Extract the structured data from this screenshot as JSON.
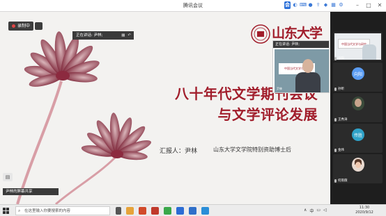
{
  "window": {
    "title": "腾讯会议"
  },
  "toolbar_icons": [
    "app-icon",
    "chat-icon",
    "keyboard-icon",
    "mic-icon",
    "share-icon",
    "shirt-icon",
    "grid-icon",
    "settings-icon"
  ],
  "stage": {
    "recording_label": "录制中",
    "speaking_label": "正在讲话: 尹林;",
    "slide": {
      "title_line1": "八十年代文学期刊会议",
      "title_line2": "与文学评论发展",
      "reporter": "汇报人：尹林",
      "organization": "山东大学文学院特别资助博士后",
      "logo_text": "山东大学",
      "accent_color": "#a11d2b"
    },
    "floating_video": {
      "header": "正在讲话: 尹林;",
      "banner": "中国当代文学与研究",
      "name": "尹林"
    },
    "screen_share_tag": "尹林的屏幕共享"
  },
  "participants": [
    {
      "name": "张阳",
      "type": "video",
      "banner": "中国当代文学与研究"
    },
    {
      "name": "孙昕",
      "type": "avatar",
      "avatar_text": "向阳",
      "color": "#5a9cf2"
    },
    {
      "name": "王秀涛",
      "type": "video"
    },
    {
      "name": "金炜",
      "type": "avatar",
      "avatar_text": "传胜",
      "color": "#2fa2c8"
    },
    {
      "name": "何雨薇",
      "type": "avatar",
      "avatar_text": "",
      "color": "#e8d9cf"
    }
  ],
  "taskbar": {
    "search_placeholder": "在这里输入你要搜索的内容",
    "ime": "中",
    "time": "11:30",
    "date": "2020/9/12"
  }
}
